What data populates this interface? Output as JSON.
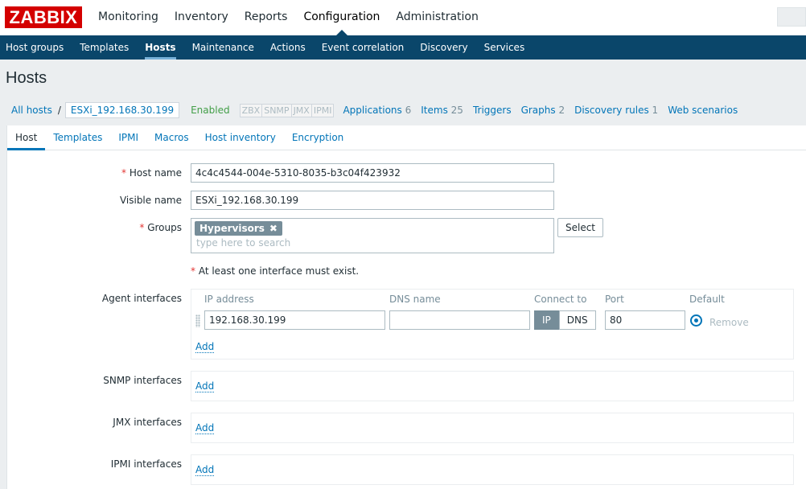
{
  "logo": "ZABBIX",
  "main_menu": [
    "Monitoring",
    "Inventory",
    "Reports",
    "Configuration",
    "Administration"
  ],
  "main_menu_active": "Configuration",
  "sub_menu": [
    "Host groups",
    "Templates",
    "Hosts",
    "Maintenance",
    "Actions",
    "Event correlation",
    "Discovery",
    "Services"
  ],
  "sub_menu_active": "Hosts",
  "page_title": "Hosts",
  "breadcrumb": {
    "all_hosts": "All hosts",
    "separator": "/",
    "current": "ESXi_192.168.30.199",
    "status": "Enabled",
    "availability": [
      "ZBX",
      "SNMP",
      "JMX",
      "IPMI"
    ],
    "links": [
      {
        "label": "Applications",
        "count": "6"
      },
      {
        "label": "Items",
        "count": "25"
      },
      {
        "label": "Triggers",
        "count": ""
      },
      {
        "label": "Graphs",
        "count": "2"
      },
      {
        "label": "Discovery rules",
        "count": "1"
      },
      {
        "label": "Web scenarios",
        "count": ""
      }
    ]
  },
  "tabs": [
    "Host",
    "Templates",
    "IPMI",
    "Macros",
    "Host inventory",
    "Encryption"
  ],
  "tabs_active": "Host",
  "form": {
    "required_mark": "*",
    "host_name_label": "Host name",
    "host_name_value": "4c4c4544-004e-5310-8035-b3c04f423932",
    "visible_name_label": "Visible name",
    "visible_name_value": "ESXi_192.168.30.199",
    "groups_label": "Groups",
    "groups_chip": "Hypervisors",
    "groups_chip_remove": "✖",
    "groups_placeholder": "type here to search",
    "select_button": "Select",
    "interface_hint": "At least one interface must exist."
  },
  "agent_interfaces": {
    "label": "Agent interfaces",
    "headers": {
      "ip": "IP address",
      "dns": "DNS name",
      "connect": "Connect to",
      "port": "Port",
      "default": "Default"
    },
    "row": {
      "ip": "192.168.30.199",
      "dns": "",
      "connect_options": [
        "IP",
        "DNS"
      ],
      "connect_selected": "IP",
      "port": "80",
      "remove": "Remove"
    },
    "add": "Add"
  },
  "snmp_interfaces": {
    "label": "SNMP interfaces",
    "add": "Add"
  },
  "jmx_interfaces": {
    "label": "JMX interfaces",
    "add": "Add"
  },
  "ipmi_interfaces": {
    "label": "IPMI interfaces",
    "add": "Add"
  }
}
